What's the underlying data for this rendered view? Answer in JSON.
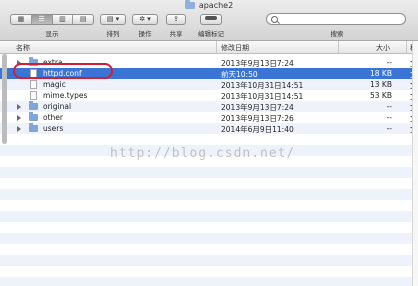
{
  "window": {
    "title": "apache2"
  },
  "toolbar": {
    "view_segments": [
      "▦",
      "☰",
      "▥",
      "▤"
    ],
    "view_label": "显示",
    "arrange_label": "排列",
    "action_label": "操作",
    "share_label": "共享",
    "edit_tags_label": "编辑标记",
    "search_label": "搜索",
    "search_value": ""
  },
  "columns": {
    "name": "名称",
    "date": "修改日期",
    "size": "大小",
    "kind": "种"
  },
  "files": [
    {
      "name": "extra",
      "date": "2013年9月13日7:24",
      "size": "--",
      "kind": "文",
      "type": "folder",
      "expandable": true,
      "selected": false
    },
    {
      "name": "httpd.conf",
      "date": "前天10:50",
      "size": "18 KB",
      "kind": "文",
      "type": "file",
      "expandable": false,
      "selected": true
    },
    {
      "name": "magic",
      "date": "2013年10月31日14:51",
      "size": "13 KB",
      "kind": "文",
      "type": "file",
      "expandable": false,
      "selected": false
    },
    {
      "name": "mime.types",
      "date": "2013年10月31日14:51",
      "size": "53 KB",
      "kind": "文",
      "type": "file",
      "expandable": false,
      "selected": false
    },
    {
      "name": "original",
      "date": "2013年9月13日7:24",
      "size": "--",
      "kind": "文",
      "type": "folder",
      "expandable": true,
      "selected": false
    },
    {
      "name": "other",
      "date": "2013年9月13日7:26",
      "size": "--",
      "kind": "文",
      "type": "folder",
      "expandable": true,
      "selected": false
    },
    {
      "name": "users",
      "date": "2014年6月9日11:40",
      "size": "--",
      "kind": "文",
      "type": "folder",
      "expandable": true,
      "selected": false
    }
  ],
  "watermark": "http://blog.csdn.net/",
  "colors": {
    "selection": "#3a75d6",
    "highlight_ring": "#d11f3a",
    "stripe": "#eef3fb"
  }
}
